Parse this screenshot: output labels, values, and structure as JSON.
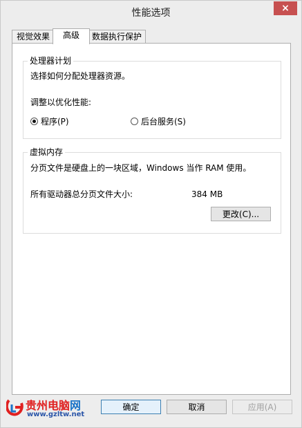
{
  "window": {
    "title": "性能选项",
    "close_glyph": "×"
  },
  "tabs": [
    {
      "label": "视觉效果",
      "active": false
    },
    {
      "label": "高级",
      "active": true
    },
    {
      "label": "数据执行保护",
      "active": false
    }
  ],
  "processor": {
    "title": "处理器计划",
    "description": "选择如何分配处理器资源。",
    "optimize_label": "调整以优化性能:",
    "options": [
      {
        "label": "程序(P)",
        "checked": true
      },
      {
        "label": "后台服务(S)",
        "checked": false
      }
    ]
  },
  "virtual_memory": {
    "title": "虚拟内存",
    "description": "分页文件是硬盘上的一块区域，Windows 当作 RAM 使用。",
    "total_label": "所有驱动器总分页文件大小:",
    "total_value": "384 MB",
    "change_button": "更改(C)..."
  },
  "buttons": {
    "ok": "确定",
    "cancel": "取消",
    "apply": "应用(A)"
  },
  "watermark": {
    "name_cn": "贵州电脑",
    "name_suffix": "网",
    "url": "www.gzltw.net"
  },
  "colors": {
    "close": "#c75050",
    "accent": "#3c7fb1",
    "logo_red": "#e02020",
    "logo_blue": "#1a73c8"
  }
}
